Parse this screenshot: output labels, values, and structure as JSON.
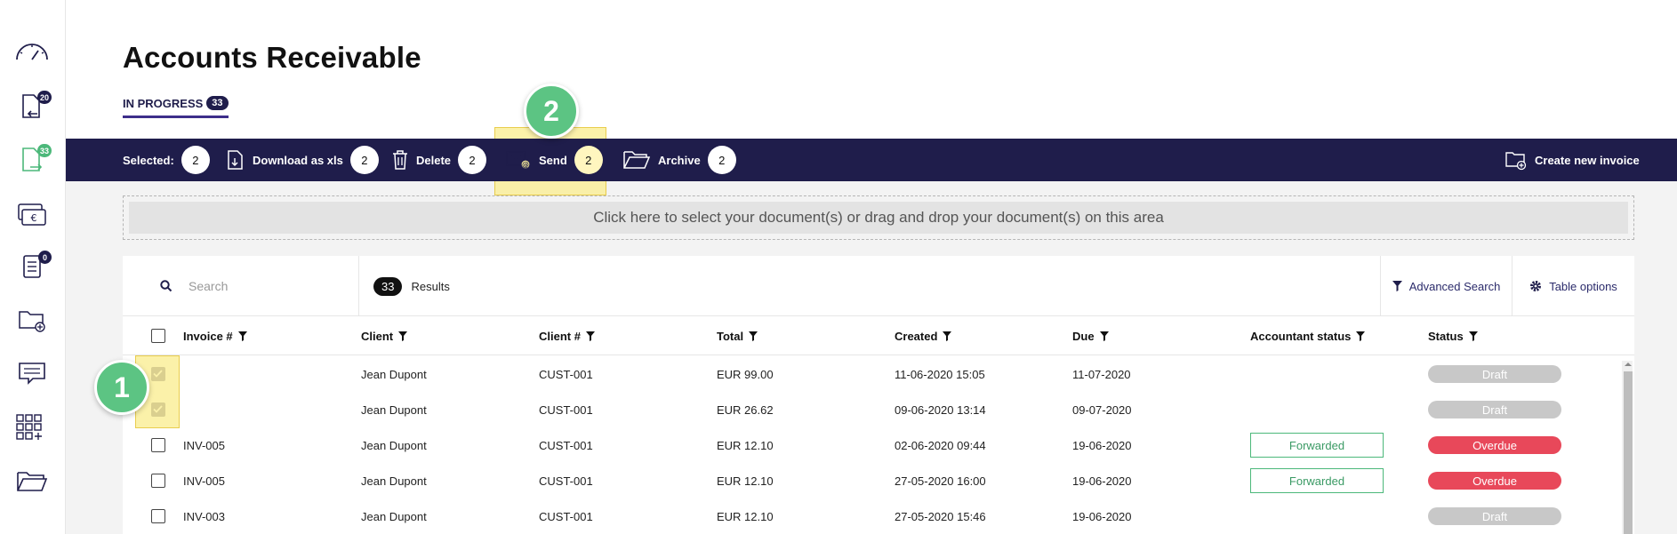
{
  "sidebar": {
    "items": [
      {
        "name": "dashboard",
        "badge": ""
      },
      {
        "name": "payables",
        "badge": "20"
      },
      {
        "name": "receivables",
        "badge": "33"
      },
      {
        "name": "payments",
        "badge": ""
      },
      {
        "name": "tasks",
        "badge": "0"
      },
      {
        "name": "add-folder",
        "badge": ""
      },
      {
        "name": "messages",
        "badge": ""
      },
      {
        "name": "apps",
        "badge": ""
      },
      {
        "name": "folder",
        "badge": ""
      }
    ]
  },
  "header": {
    "title": "Accounts Receivable",
    "tab_label": "IN PROGRESS",
    "tab_count": "33"
  },
  "toolbar": {
    "selected_label": "Selected:",
    "selected_count": "2",
    "download_label": "Download as xls",
    "download_count": "2",
    "delete_label": "Delete",
    "delete_count": "2",
    "send_label": "Send",
    "send_count": "2",
    "archive_label": "Archive",
    "archive_count": "2",
    "create_label": "Create new invoice"
  },
  "dropzone": {
    "text": "Click here to select your document(s) or drag and drop your document(s) on this area"
  },
  "search": {
    "placeholder": "Search",
    "results_count": "33",
    "results_label": "Results",
    "advanced_label": "Advanced Search",
    "table_options_label": "Table options"
  },
  "table": {
    "columns": {
      "invoice": "Invoice #",
      "client": "Client",
      "client_no": "Client #",
      "total": "Total",
      "created": "Created",
      "due": "Due",
      "accountant_status": "Accountant status",
      "status": "Status"
    },
    "rows": [
      {
        "checked": true,
        "invoice": "",
        "client": "Jean Dupont",
        "client_no": "CUST-001",
        "total": "EUR 99.00",
        "created": "11-06-2020 15:05",
        "due": "11-07-2020",
        "accountant_status": "",
        "status": "Draft"
      },
      {
        "checked": true,
        "invoice": "",
        "client": "Jean Dupont",
        "client_no": "CUST-001",
        "total": "EUR 26.62",
        "created": "09-06-2020 13:14",
        "due": "09-07-2020",
        "accountant_status": "",
        "status": "Draft"
      },
      {
        "checked": false,
        "invoice": "INV-005",
        "client": "Jean Dupont",
        "client_no": "CUST-001",
        "total": "EUR 12.10",
        "created": "02-06-2020 09:44",
        "due": "19-06-2020",
        "accountant_status": "Forwarded",
        "status": "Overdue"
      },
      {
        "checked": false,
        "invoice": "INV-005",
        "client": "Jean Dupont",
        "client_no": "CUST-001",
        "total": "EUR 12.10",
        "created": "27-05-2020 16:00",
        "due": "19-06-2020",
        "accountant_status": "Forwarded",
        "status": "Overdue"
      },
      {
        "checked": false,
        "invoice": "INV-003",
        "client": "Jean Dupont",
        "client_no": "CUST-001",
        "total": "EUR 12.10",
        "created": "27-05-2020 15:46",
        "due": "19-06-2020",
        "accountant_status": "",
        "status": "Draft"
      }
    ]
  },
  "callouts": {
    "one": "1",
    "two": "2"
  },
  "colors": {
    "navy": "#1f1d4b",
    "draft": "#c8c8c8",
    "overdue": "#e8485a",
    "forwarded": "#4cb87a",
    "callout": "#5cc483",
    "highlight": "#fbef9b"
  }
}
